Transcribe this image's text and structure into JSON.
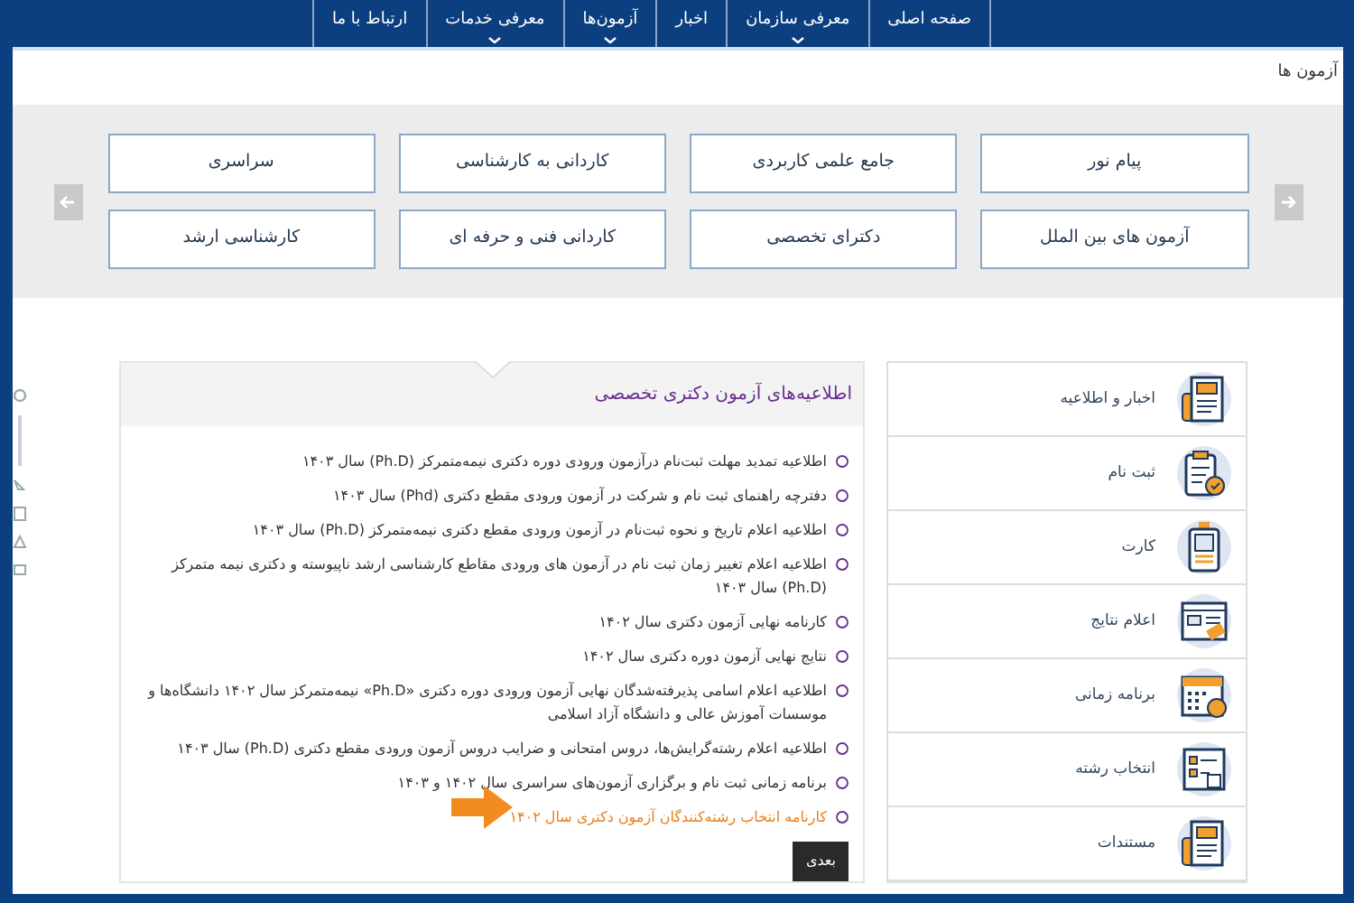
{
  "nav": [
    {
      "label": "صفحه اصلی",
      "has_submenu": false
    },
    {
      "label": "معرفی سازمان",
      "has_submenu": true
    },
    {
      "label": "اخبار",
      "has_submenu": false
    },
    {
      "label": "آزمون‌ها",
      "has_submenu": true
    },
    {
      "label": "معرفی خدمات",
      "has_submenu": true
    },
    {
      "label": "ارتباط با ما",
      "has_submenu": false
    }
  ],
  "breadcrumb": "آزمون ها",
  "exam_buttons": [
    [
      "پیام نور",
      "جامع علمی کاربردی",
      "کاردانی به کارشناسی",
      "سراسری"
    ],
    [
      "آزمون های بین الملل",
      "دکترای تخصصی",
      "کاردانی فنی و حرفه ای",
      "کارشناسی ارشد"
    ]
  ],
  "announcements": {
    "title": "اطلاعیه‌های آزمون دکتری تخصصی",
    "items": [
      {
        "text": "اطلاعیه تمدید مهلت ثبت‌نام درآزمون ورودی دوره دکتری نیمه‌متمرکز (Ph.D) سال ۱۴۰۳",
        "highlighted": false
      },
      {
        "text": "دفترچه راهنمای ثبت نام و شرکت در آزمون ورودی مقطع دکتری (Phd) سال ۱۴۰۳",
        "highlighted": false
      },
      {
        "text": "اطلاعیه اعلام تاریخ و نحوه ثبت‌نام در آزمون ورودی مقطع دکتری نیمه‌متمرکز (Ph.D) سال ۱۴۰۳",
        "highlighted": false
      },
      {
        "text": "اطلاعیه اعلام تغییر زمان ثبت نام در آزمون های ورودی مقاطع کارشناسی ارشد ناپیوسته و دکتری نیمه متمرکز (Ph.D) سال ۱۴۰۳",
        "highlighted": false
      },
      {
        "text": "کارنامه نهایی آزمون دکتری سال ۱۴۰۲",
        "highlighted": false
      },
      {
        "text": "نتایج نهایی آزمون دوره دکتری سال ۱۴۰۲",
        "highlighted": false
      },
      {
        "text": "اطلاعیه اعلام اسامی پذیرفته‌شدگان نهایی آزمون ورودی دوره دکتری «Ph.D» نیمه‌متمرکز سال ۱۴۰۲ دانشگاه‌ها و موسسات آموزش عالی و دانشگاه آزاد اسلامی",
        "highlighted": false
      },
      {
        "text": "اطلاعیه اعلام رشته‌گرایش‌ها، دروس امتحانی و ضرایب دروس آزمون ورودی مقطع دکتری (Ph.D) سال ۱۴۰۳",
        "highlighted": false
      },
      {
        "text": "برنامه زمانی ثبت نام و برگزاری آزمون‌های سراسری سال ۱۴۰۲ و ۱۴۰۳",
        "highlighted": false
      },
      {
        "text": "کارنامه انتخاب رشته‌کنندگان آزمون دکتری سال ۱۴۰۲",
        "highlighted": true
      }
    ],
    "next_button": "بعدی"
  },
  "sidebar": [
    "اخبار و اطلاعیه",
    "ثبت نام",
    "کارت",
    "اعلام نتایج",
    "برنامه زمانی",
    "انتخاب رشته",
    "مستندات"
  ]
}
